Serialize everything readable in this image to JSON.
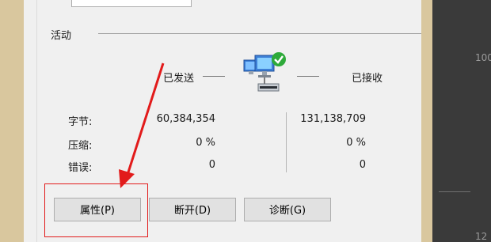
{
  "section": {
    "label": "活动"
  },
  "traffic": {
    "sent_label": "已发送",
    "received_label": "已接收"
  },
  "rows": [
    {
      "label": "字节:",
      "sent": "60,384,354",
      "received": "131,138,709"
    },
    {
      "label": "压缩:",
      "sent": "0 %",
      "received": "0 %"
    },
    {
      "label": "错误:",
      "sent": "0",
      "received": "0"
    }
  ],
  "buttons": {
    "properties": "属性(P)",
    "disconnect": "断开(D)",
    "diagnose": "诊断(G)"
  },
  "background": {
    "label_top": "100",
    "label_bottom": "12"
  },
  "icons": {
    "network": "network-computer-icon",
    "status": "green-check-icon"
  },
  "colors": {
    "highlight": "#e21b1b",
    "arrow": "#e21b1b",
    "check": "#2eaa3a"
  }
}
